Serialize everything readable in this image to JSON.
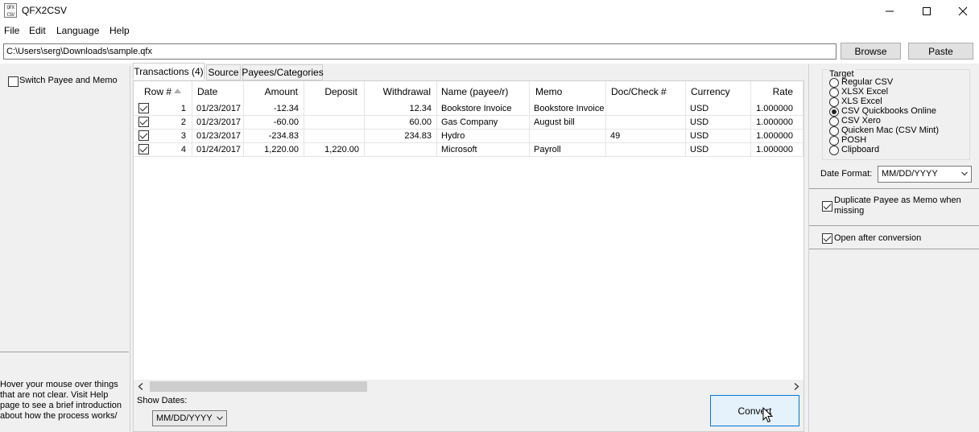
{
  "app": {
    "icon_text": "QFX CSV",
    "title": "QFX2CSV"
  },
  "window_controls": {
    "minimize": "minimize-icon",
    "maximize": "maximize-icon",
    "close": "close-icon"
  },
  "menu": [
    "File",
    "Edit",
    "Language",
    "Help"
  ],
  "path": {
    "value": "C:\\Users\\serg\\Downloads\\sample.qfx"
  },
  "buttons": {
    "browse": "Browse",
    "paste": "Paste",
    "convert": "Convert"
  },
  "left": {
    "switch_label": "Switch Payee and Memo",
    "help_text": "Hover your mouse over things that are not clear. Visit Help page to see a brief introduction about how the process works/"
  },
  "tabs": [
    "Transactions (4)",
    "Source",
    "Payees/Categories"
  ],
  "grid": {
    "columns": [
      "Row #",
      "Date",
      "Amount",
      "Deposit",
      "Withdrawal",
      "Name (payee/r)",
      "Memo",
      "Doc/Check #",
      "Currency",
      "Rate"
    ],
    "rows": [
      {
        "row": "1",
        "date": "01/23/2017",
        "amount": "-12.34",
        "deposit": "",
        "withdrawal": "12.34",
        "name": "Bookstore Invoice",
        "memo": "Bookstore Invoice",
        "doc": "",
        "currency": "USD",
        "rate": "1.000000"
      },
      {
        "row": "2",
        "date": "01/23/2017",
        "amount": "-60.00",
        "deposit": "",
        "withdrawal": "60.00",
        "name": "Gas Company",
        "memo": "August bill",
        "doc": "",
        "currency": "USD",
        "rate": "1.000000"
      },
      {
        "row": "3",
        "date": "01/23/2017",
        "amount": "-234.83",
        "deposit": "",
        "withdrawal": "234.83",
        "name": "Hydro",
        "memo": "",
        "doc": "49",
        "currency": "USD",
        "rate": "1.000000"
      },
      {
        "row": "4",
        "date": "01/24/2017",
        "amount": "1,220.00",
        "deposit": "1,220.00",
        "withdrawal": "",
        "name": "Microsoft",
        "memo": "Payroll",
        "doc": "",
        "currency": "USD",
        "rate": "1.000000"
      }
    ]
  },
  "show_dates": {
    "label": "Show Dates:",
    "value": "MM/DD/YYYY"
  },
  "target": {
    "label": "Target",
    "options": [
      "Regular CSV",
      "XLSX Excel",
      "XLS Excel",
      "CSV Quickbooks Online",
      "CSV Xero",
      "Quicken Mac (CSV Mint)",
      "POSH",
      "Clipboard"
    ],
    "selected": "CSV Quickbooks Online"
  },
  "date_format": {
    "label": "Date Format:",
    "value": "MM/DD/YYYY"
  },
  "options": {
    "duplicate_label": "Duplicate Payee as Memo when missing",
    "open_after_label": "Open after conversion"
  }
}
